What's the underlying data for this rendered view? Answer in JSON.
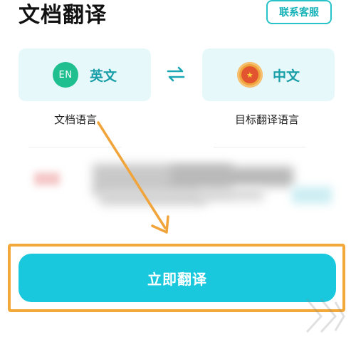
{
  "header": {
    "title": "文档翻译",
    "service_label": "联系客服"
  },
  "languages": {
    "source": {
      "badge": "EN",
      "name": "英文",
      "caption": "文档语言"
    },
    "target": {
      "badge": "★",
      "name": "中文",
      "caption": "目标翻译语言"
    },
    "swap_icon": "swap-arrows-icon"
  },
  "actions": {
    "translate_label": "立即翻译"
  },
  "colors": {
    "accent": "#19c8dd",
    "highlight_border": "#f3a93a",
    "card_bg": "#e6f8fa"
  }
}
